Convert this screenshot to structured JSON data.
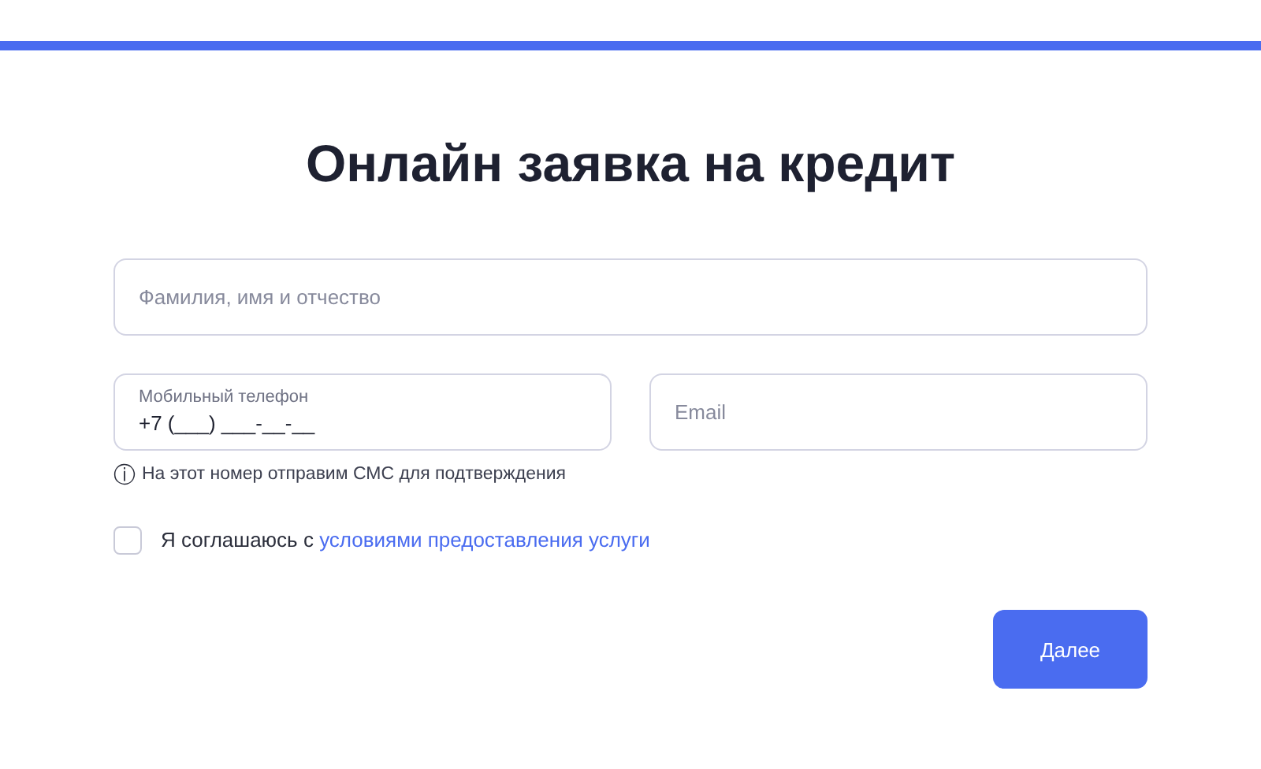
{
  "title": "Онлайн заявка на кредит",
  "fields": [
    {
      "kind": "text",
      "placeholder": "Фамилия, имя и отчество"
    },
    {
      "kind": "floating",
      "label": "Мобильный телефон",
      "value": "+7 (___) ___-__-__"
    },
    {
      "kind": "text",
      "placeholder": "Email"
    }
  ],
  "hint": {
    "icon": "ⓘ",
    "text": "На этот номер отправим СМС для подтверждения"
  },
  "agreement": {
    "checked": false,
    "text": "Я соглашаюсь с",
    "link": "условиями предоставления услуги"
  },
  "buttons": [
    "Далее"
  ]
}
